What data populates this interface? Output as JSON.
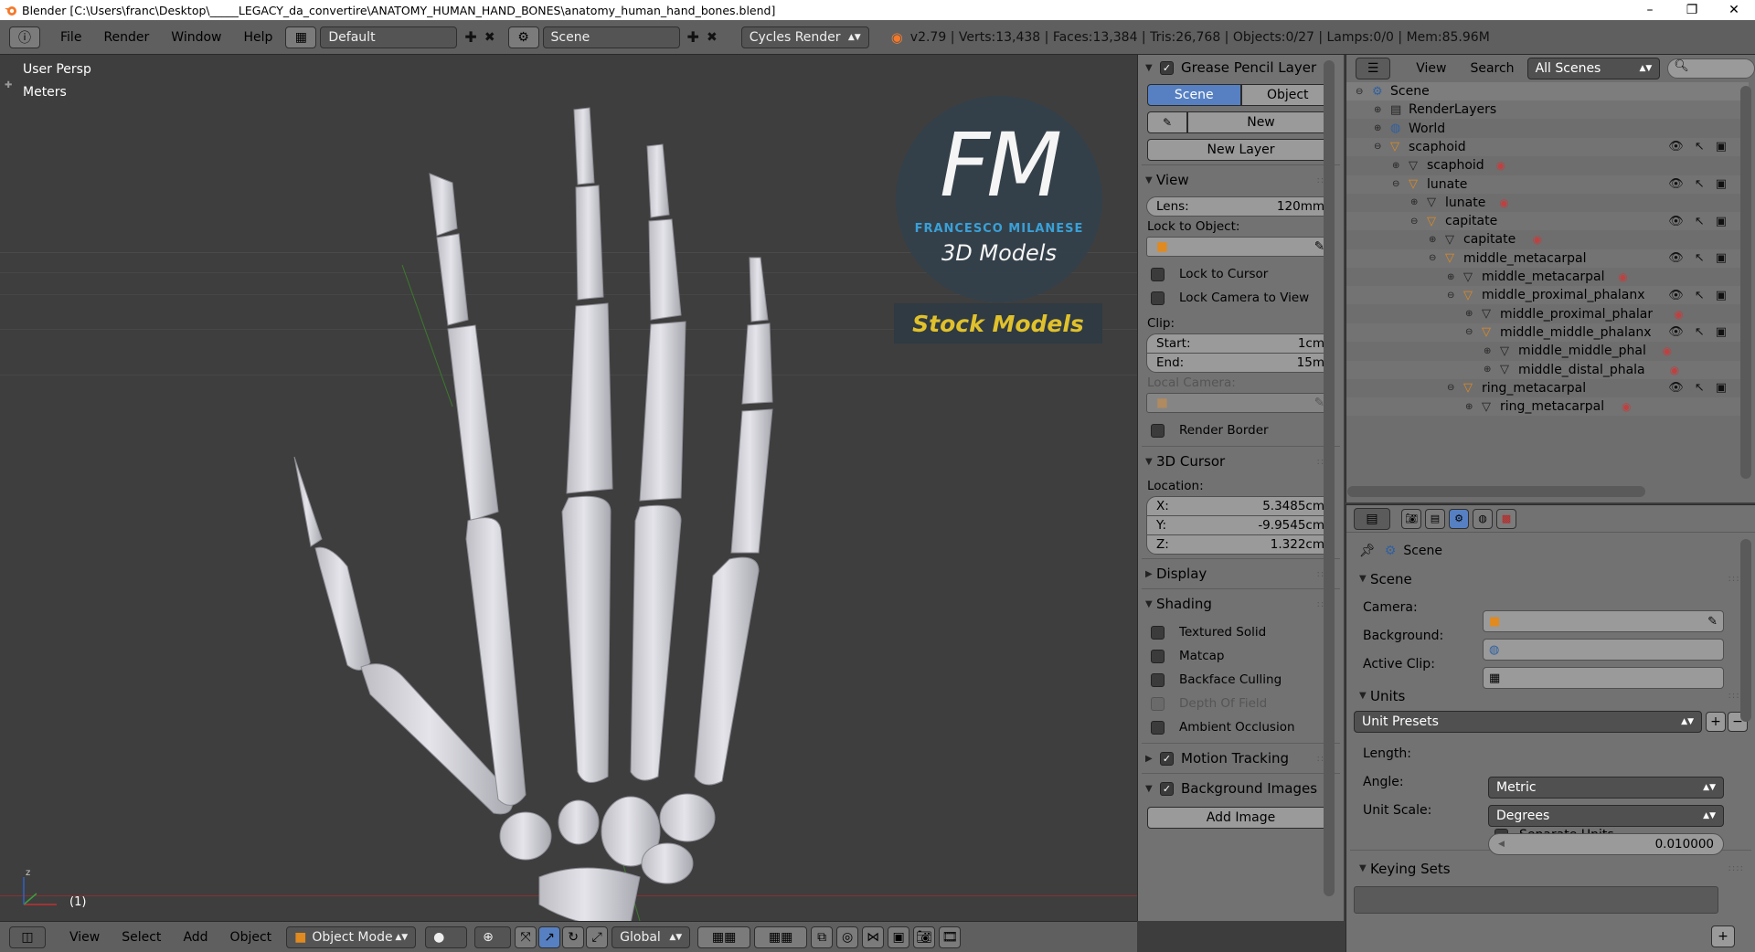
{
  "window": {
    "title": "Blender [C:\\Users\\franc\\Desktop\\_____LEGACY_da_convertire\\ANATOMY_HUMAN_HAND_BONES\\anatomy_human_hand_bones.blend]",
    "minimize": "–",
    "maximize": "❐",
    "close": "✕"
  },
  "topbar": {
    "menus": [
      "File",
      "Render",
      "Window",
      "Help"
    ],
    "layout": "Default",
    "scene": "Scene",
    "engine": "Cycles Render",
    "stats": "v2.79 | Verts:13,438 | Faces:13,384 | Tris:26,768 | Objects:0/27 | Lamps:0/0 | Mem:85.96M"
  },
  "viewport": {
    "view_name": "User Persp",
    "units": "Meters",
    "frame": "(1)",
    "logo_letters": "FM",
    "logo_name": "FRANCESCO MILANESE",
    "logo_sub": "3D Models",
    "stock": "Stock Models"
  },
  "npanel": {
    "grease_pencil": "Grease Pencil Layer",
    "tab_scene": "Scene",
    "tab_object": "Object",
    "new": "New",
    "new_layer": "New Layer",
    "view_header": "View",
    "lens_label": "Lens:",
    "lens_value": "120mm",
    "lock_to_object": "Lock to Object:",
    "lock_to_cursor": "Lock to Cursor",
    "lock_camera": "Lock Camera to View",
    "clip": "Clip:",
    "start_label": "Start:",
    "start_value": "1cm",
    "end_label": "End:",
    "end_value": "15m",
    "local_camera": "Local Camera:",
    "render_border": "Render Border",
    "cursor_header": "3D Cursor",
    "location": "Location:",
    "x_label": "X:",
    "x_value": "5.3485cm",
    "y_label": "Y:",
    "y_value": "-9.9545cm",
    "z_label": "Z:",
    "z_value": "1.322cm",
    "display_header": "Display",
    "shading_header": "Shading",
    "textured_solid": "Textured Solid",
    "matcap": "Matcap",
    "backface": "Backface Culling",
    "dof": "Depth Of Field",
    "ao": "Ambient Occlusion",
    "motion_tracking": "Motion Tracking",
    "bg_images": "Background Images",
    "add_image": "Add Image"
  },
  "outliner": {
    "view": "View",
    "search": "Search",
    "filter": "All Scenes",
    "rows": [
      {
        "label": "Scene"
      },
      {
        "label": "RenderLayers"
      },
      {
        "label": "World"
      },
      {
        "label": "scaphoid"
      },
      {
        "label": "scaphoid"
      },
      {
        "label": "lunate"
      },
      {
        "label": "lunate"
      },
      {
        "label": "capitate"
      },
      {
        "label": "capitate"
      },
      {
        "label": "middle_metacarpal"
      },
      {
        "label": "middle_metacarpal"
      },
      {
        "label": "middle_proximal_phalanx"
      },
      {
        "label": "middle_proximal_phalar"
      },
      {
        "label": "middle_middle_phalanx"
      },
      {
        "label": "middle_middle_phal"
      },
      {
        "label": "middle_distal_phala"
      },
      {
        "label": "ring_metacarpal"
      },
      {
        "label": "ring_metacarpal"
      }
    ]
  },
  "properties": {
    "breadcrumb": "Scene",
    "scene_header": "Scene",
    "camera": "Camera:",
    "background": "Background:",
    "active_clip": "Active Clip:",
    "units_header": "Units",
    "unit_presets": "Unit Presets",
    "length": "Length:",
    "length_value": "Metric",
    "angle": "Angle:",
    "angle_value": "Degrees",
    "unit_scale": "Unit Scale:",
    "unit_scale_value": "0.010000",
    "separate_units": "Separate Units",
    "keying_sets": "Keying Sets"
  },
  "bottombar": {
    "menus": [
      "View",
      "Select",
      "Add",
      "Object"
    ],
    "mode": "Object Mode",
    "orientation": "Global"
  }
}
